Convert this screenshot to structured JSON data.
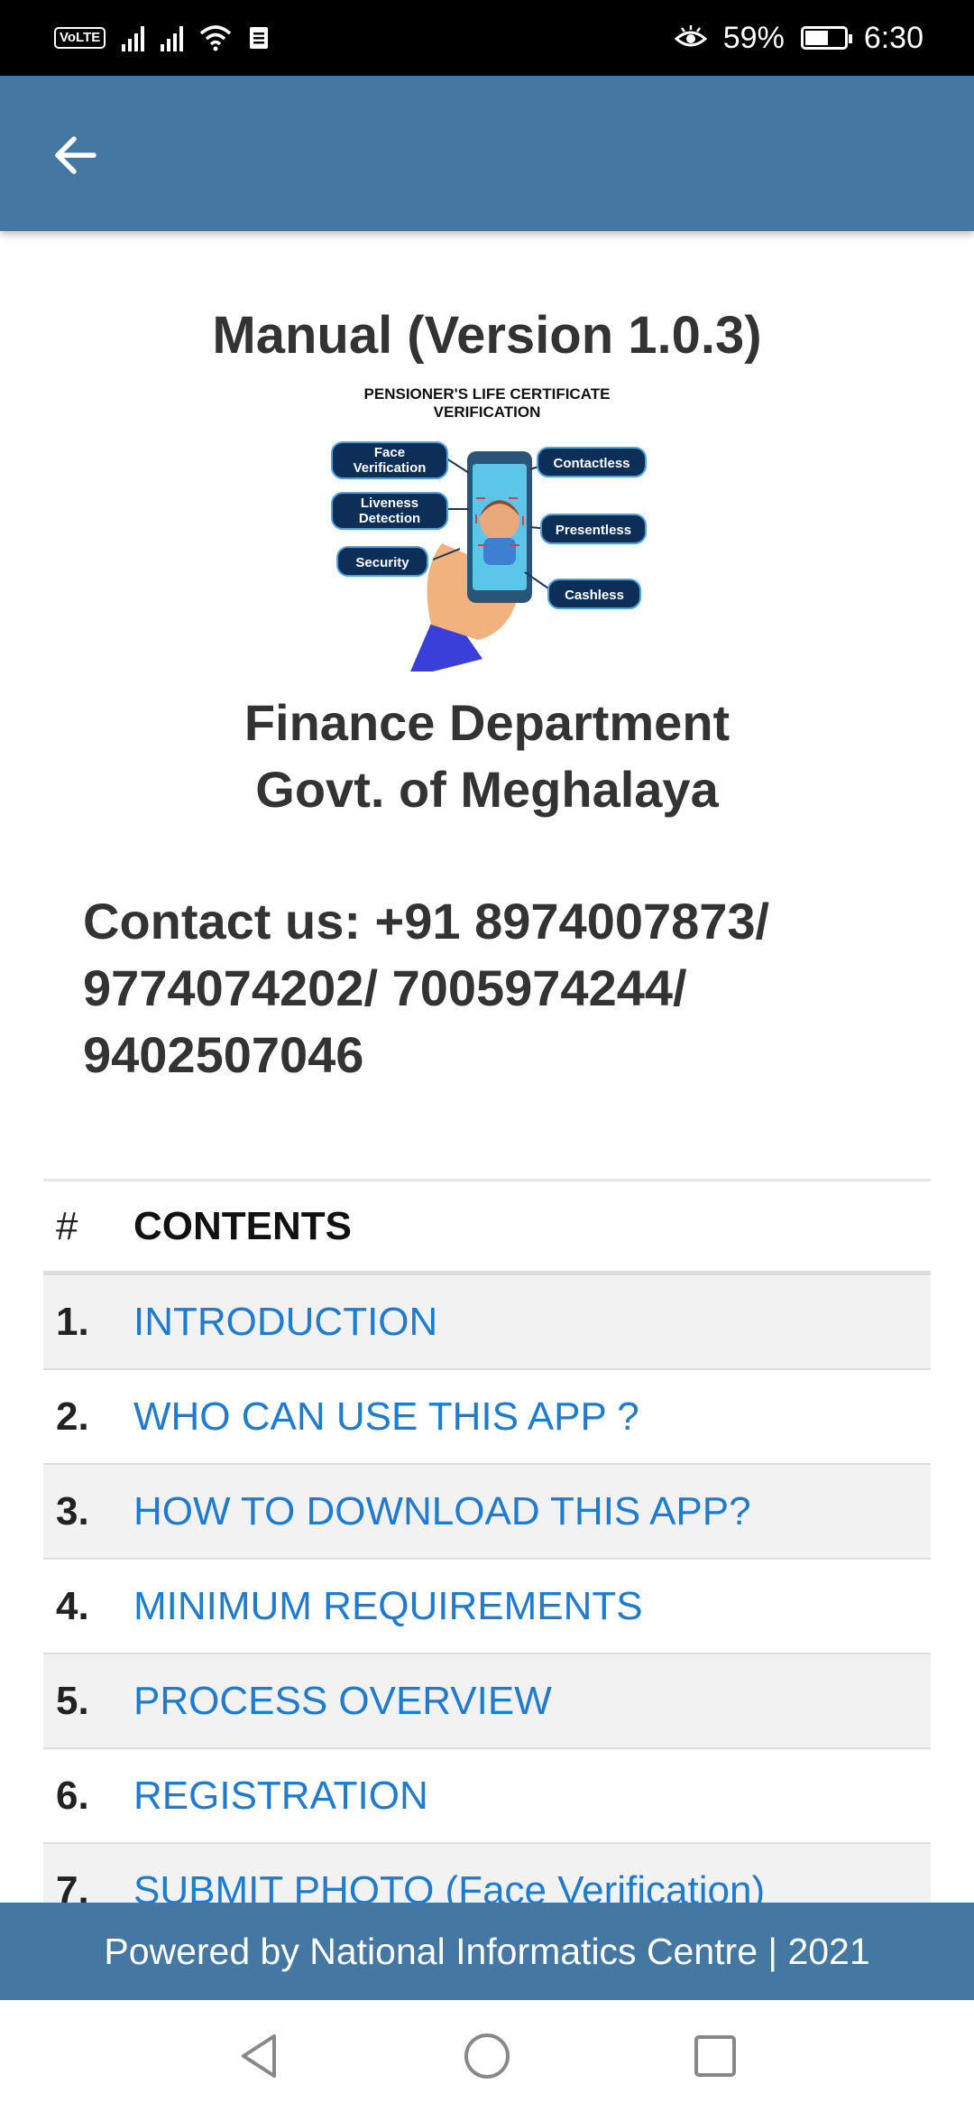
{
  "status_bar": {
    "volte": "VoLTE",
    "battery_percent": "59%",
    "battery_level": 0.59,
    "time": "6:30"
  },
  "icons": {
    "back": "arrow-left-icon",
    "eye": "eye-comfort-icon",
    "wifi": "wifi-icon",
    "signal": "signal-icon"
  },
  "colors": {
    "app_bar": "#4577a3",
    "link": "#1e7bd0",
    "text": "#333333"
  },
  "page": {
    "title": "Manual (Version 1.0.3)",
    "illustration": {
      "heading_line1": "PENSIONER'S LIFE CERTIFICATE",
      "heading_line2": "VERIFICATION",
      "face_verification_1": "Face",
      "face_verification_2": "Verification",
      "liveness_1": "Liveness",
      "liveness_2": "Detection",
      "security": "Security",
      "contactless": "Contactless",
      "presentless": "Presentless",
      "cashless": "Cashless"
    },
    "dept_line1": "Finance Department",
    "dept_line2": "Govt. of Meghalaya",
    "contact_line1": "Contact us: +91 8974007873/",
    "contact_line2": "9774074202/ 7005974244/",
    "contact_line3": "9402507046"
  },
  "contents": {
    "header_num": "#",
    "header_label": "CONTENTS",
    "items": [
      {
        "num": "1.",
        "label": "INTRODUCTION"
      },
      {
        "num": "2.",
        "label": "WHO CAN USE THIS APP ?"
      },
      {
        "num": "3.",
        "label": "HOW TO DOWNLOAD THIS APP?"
      },
      {
        "num": "4.",
        "label": "MINIMUM REQUIREMENTS"
      },
      {
        "num": "5.",
        "label": "PROCESS OVERVIEW"
      },
      {
        "num": "6.",
        "label": "REGISTRATION"
      },
      {
        "num": "7.",
        "label": "SUBMIT PHOTO (Face Verification)"
      }
    ]
  },
  "footer": {
    "text": "Powered by National Informatics Centre | 2021"
  }
}
